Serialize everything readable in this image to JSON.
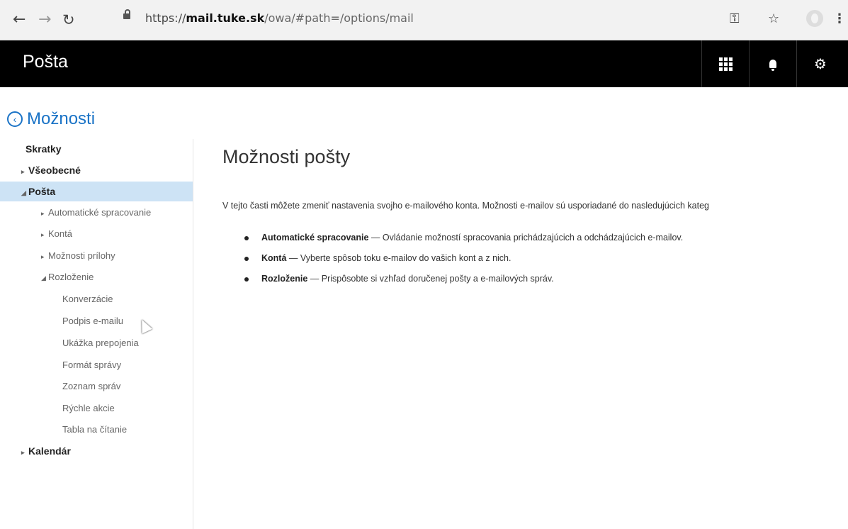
{
  "browser": {
    "url_scheme": "https://",
    "url_domain": "mail.tuke.sk",
    "url_path": "/owa/#path=/options/mail"
  },
  "appbar": {
    "title": "Pošta",
    "icons": [
      "app-launcher-icon",
      "bell-icon",
      "gear-icon"
    ]
  },
  "options_header": "Možnosti",
  "sidebar": {
    "items": [
      {
        "label": "Skratky",
        "level": 0,
        "expander": "none",
        "selected": false
      },
      {
        "label": "Všeobecné",
        "level": 0,
        "expander": "collapsed",
        "selected": false
      },
      {
        "label": "Pošta",
        "level": 0,
        "expander": "expanded",
        "selected": true
      },
      {
        "label": "Automatické spracovanie",
        "level": 1,
        "expander": "collapsed",
        "selected": false
      },
      {
        "label": "Kontá",
        "level": 1,
        "expander": "collapsed",
        "selected": false
      },
      {
        "label": "Možnosti prílohy",
        "level": 1,
        "expander": "collapsed",
        "selected": false
      },
      {
        "label": "Rozloženie",
        "level": 1,
        "expander": "expanded",
        "selected": false
      },
      {
        "label": "Konverzácie",
        "level": 2,
        "expander": "none",
        "selected": false
      },
      {
        "label": "Podpis e-mailu",
        "level": 2,
        "expander": "none",
        "selected": false
      },
      {
        "label": "Ukážka prepojenia",
        "level": 2,
        "expander": "none",
        "selected": false
      },
      {
        "label": "Formát správy",
        "level": 2,
        "expander": "none",
        "selected": false
      },
      {
        "label": "Zoznam správ",
        "level": 2,
        "expander": "none",
        "selected": false
      },
      {
        "label": "Rýchle akcie",
        "level": 2,
        "expander": "none",
        "selected": false
      },
      {
        "label": "Tabla na čítanie",
        "level": 2,
        "expander": "none",
        "selected": false
      },
      {
        "label": "Kalendár",
        "level": 0,
        "expander": "collapsed",
        "selected": false
      }
    ]
  },
  "main": {
    "title": "Možnosti pošty",
    "intro": "V tejto časti môžete zmeniť nastavenia svojho e-mailového konta. Možnosti e-mailov sú usporiadané do nasledujúcich kateg",
    "bullets": [
      {
        "term": "Automatické spracovanie",
        "text": " — Ovládanie možností spracovania prichádzajúcich a odchádzajúcich e-mailov."
      },
      {
        "term": "Kontá",
        "text": " — Vyberte spôsob toku e-mailov do vašich kont a z nich."
      },
      {
        "term": "Rozloženie",
        "text": " — Prispôsobte si vzhľad doručenej pošty a e-mailových správ."
      }
    ]
  },
  "colors": {
    "accent": "#1a73c6",
    "appbar": "#000000",
    "selected_bg": "#cde3f5"
  }
}
